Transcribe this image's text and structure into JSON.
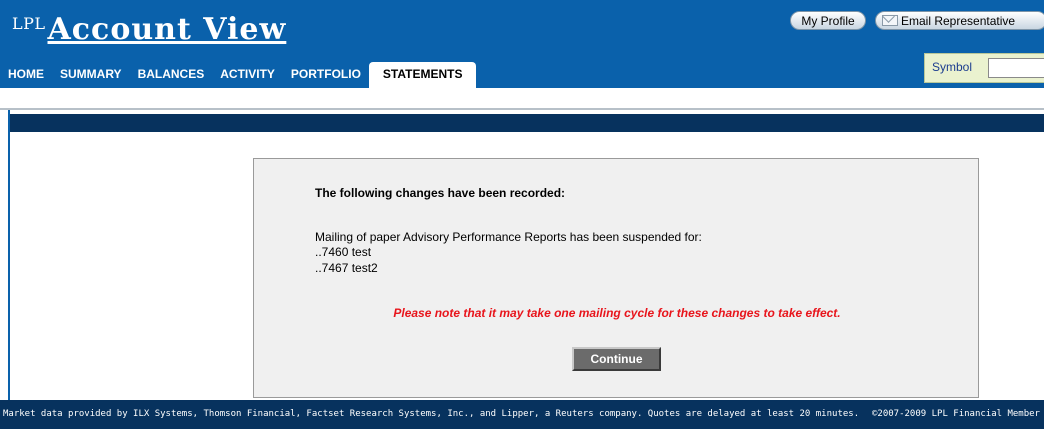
{
  "header": {
    "logo_prefix": "LPL",
    "logo_title": "Account View",
    "my_profile_label": "My Profile",
    "email_rep_label": "Email Representative",
    "email_icon": "envelope-icon"
  },
  "nav": {
    "items": [
      {
        "label": "HOME"
      },
      {
        "label": "SUMMARY"
      },
      {
        "label": "BALANCES"
      },
      {
        "label": "ACTIVITY"
      },
      {
        "label": "PORTFOLIO"
      },
      {
        "label": "STATEMENTS",
        "active": true
      }
    ]
  },
  "symbol": {
    "label": "Symbol",
    "value": ""
  },
  "message": {
    "heading": "The following changes have been recorded:",
    "body": "Mailing of paper Advisory Performance Reports has been suspended for:",
    "accounts": [
      "..7460 test",
      "..7467 test2"
    ],
    "note": "Please note that it may take one mailing cycle for these changes to take effect.",
    "continue_label": "Continue"
  },
  "footer": {
    "disclaimer": "Market data provided by ILX Systems, Thomson Financial, Factset Research Systems, Inc., and Lipper, a Reuters company. Quotes are delayed at least 20 minutes.",
    "copyright": "©2007-2009 LPL Financial Member"
  },
  "colors": {
    "header_blue": "#0a61ab",
    "dark_navy": "#07325e",
    "note_red": "#e8141b"
  }
}
